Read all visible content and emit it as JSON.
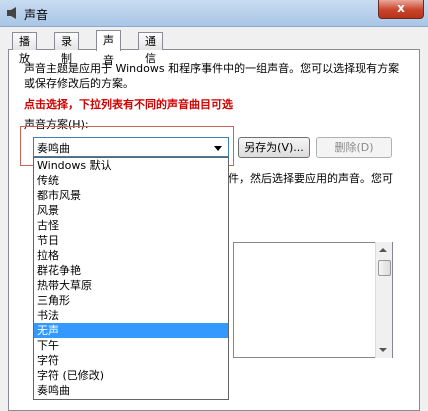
{
  "window": {
    "title": "声音",
    "close_label": "x"
  },
  "tabs": [
    "播放",
    "录制",
    "声音",
    "通信"
  ],
  "description": "声音主题是应用于 Windows 和程序事件中的一组声音。您可以选择现有方案或保存修改后的方案。",
  "red_note": "点击选择，下拉列表有不同的声音曲目可选",
  "scheme_label": "声音方案(H):",
  "scheme_value": "奏鸣曲",
  "buttons": {
    "save_as": "另存为(V)...",
    "delete": "删除(D)"
  },
  "side_text": "件，然后选择要应用的声音。您可",
  "dropdown_options": [
    "Windows 默认",
    "传统",
    "都市风景",
    "风景",
    "古怪",
    "节日",
    "拉格",
    "群花争艳",
    "热带大草原",
    "三角形",
    "书法",
    "无声",
    "下午",
    "字符",
    "字符 (已修改)",
    "奏鸣曲"
  ],
  "selected_option": "无声",
  "colors": {
    "highlight": "#3399ff",
    "note_red": "#d00000",
    "title_bar": "#b9d1ea"
  }
}
